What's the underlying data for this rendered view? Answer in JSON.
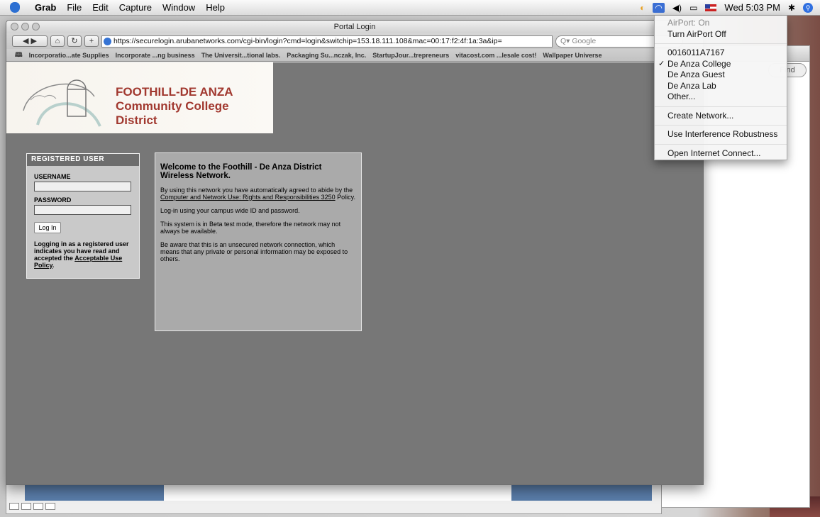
{
  "menubar": {
    "app_name": "Grab",
    "menus": [
      "File",
      "Edit",
      "Capture",
      "Window",
      "Help"
    ],
    "clock": "Wed 5:03 PM"
  },
  "browser": {
    "title": "Portal Login",
    "url": "https://securelogin.arubanetworks.com/cgi-bin/login?cmd=login&switchip=153.18.111.108&mac=00:17:f2:4f:1a:3a&ip=",
    "search_placeholder": "Google",
    "bookmarks": [
      "Incorporatio...ate Supplies",
      "Incorporate ...ng business",
      "The Universit...tional labs.",
      "Packaging Su...nczak, Inc.",
      "StartupJour...trepreneurs",
      "vitacost.com ...lesale cost!",
      "Wallpaper Universe"
    ]
  },
  "page": {
    "brand_line1": "FOOTHILL-DE ANZA",
    "brand_line2": "Community College District",
    "login": {
      "header": "REGISTERED USER",
      "username_label": "USERNAME",
      "password_label": "PASSWORD",
      "button": "Log In",
      "note_text": "Logging in as a registered user indicates you have read and accepted the",
      "note_link": "Acceptable Use Policy"
    },
    "welcome": {
      "title": "Welcome to the Foothill - De Anza District Wireless Network.",
      "p1_text": "By using this network you have automatically agreed to abide by the",
      "p1_link": "Computer and Network Use: Rights and Responsibilities 3250",
      "p1_after": "Policy.",
      "p2": "Log-in using your campus wide ID and password.",
      "p3": "This system is in Beta test mode, therefore the network may not always be available.",
      "p4": "Be aware that this is an unsecured network connection, which means that any private or personal information may be exposed to others."
    }
  },
  "airport_menu": {
    "status": "AirPort: On",
    "toggle": "Turn AirPort Off",
    "networks": [
      "0016011A7167",
      "De Anza College",
      "De Anza Guest",
      "De Anza Lab",
      "Other..."
    ],
    "selected": "De Anza College",
    "create": "Create Network...",
    "interference": "Use Interference Robustness",
    "open_connect": "Open Internet Connect..."
  },
  "background_window": {
    "find_button": "Find"
  }
}
